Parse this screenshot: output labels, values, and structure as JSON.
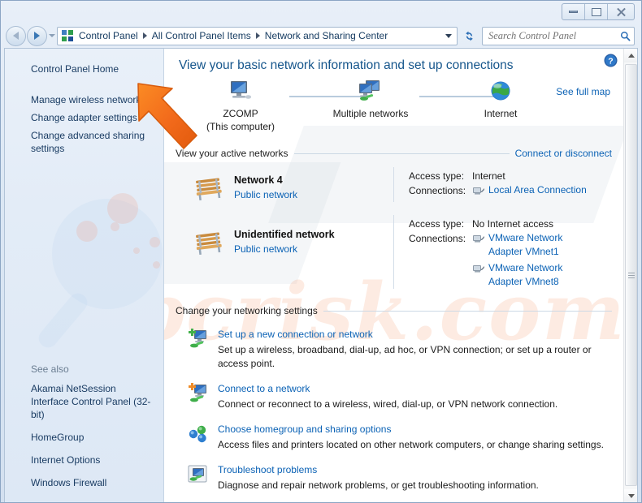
{
  "window": {
    "controls": {
      "minimize": "Minimize",
      "maximize": "Maximize",
      "close": "Close"
    }
  },
  "address_bar": {
    "back_tooltip": "Back",
    "forward_tooltip": "Forward",
    "breadcrumb": [
      "Control Panel",
      "All Control Panel Items",
      "Network and Sharing Center"
    ],
    "refresh_tooltip": "Refresh",
    "search_placeholder": "Search Control Panel",
    "search_value": ""
  },
  "sidebar": {
    "home_label": "Control Panel Home",
    "items": [
      {
        "label": "Manage wireless networks"
      },
      {
        "label": "Change adapter settings"
      },
      {
        "label": "Change advanced sharing settings"
      }
    ],
    "see_also_title": "See also",
    "see_also_items": [
      {
        "label": "Akamai NetSession Interface Control Panel (32-bit)"
      },
      {
        "label": "HomeGroup"
      },
      {
        "label": "Internet Options"
      },
      {
        "label": "Windows Firewall"
      }
    ]
  },
  "main": {
    "title": "View your basic network information and set up connections",
    "see_full_map": "See full map",
    "map_nodes": [
      {
        "label": "ZCOMP",
        "sublabel": "(This computer)",
        "icon": "computer-icon"
      },
      {
        "label": "Multiple networks",
        "sublabel": "",
        "icon": "multiple-networks-icon"
      },
      {
        "label": "Internet",
        "sublabel": "",
        "icon": "globe-icon"
      }
    ],
    "active_networks_heading": "View your active networks",
    "connect_or_disconnect": "Connect or disconnect",
    "networks": [
      {
        "name": "Network  4",
        "type": "Public network",
        "access_type_label": "Access type:",
        "access_type_value": "Internet",
        "connections_label": "Connections:",
        "connections": [
          "Local Area Connection"
        ]
      },
      {
        "name": "Unidentified network",
        "type": "Public network",
        "access_type_label": "Access type:",
        "access_type_value": "No Internet access",
        "connections_label": "Connections:",
        "connections": [
          "VMware Network Adapter VMnet1",
          "VMware Network Adapter VMnet8"
        ]
      }
    ],
    "settings_heading": "Change your networking settings",
    "tasks": [
      {
        "title": "Set up a new connection or network",
        "desc": "Set up a wireless, broadband, dial-up, ad hoc, or VPN connection; or set up a router or access point.",
        "icon": "new-connection-icon"
      },
      {
        "title": "Connect to a network",
        "desc": "Connect or reconnect to a wireless, wired, dial-up, or VPN network connection.",
        "icon": "connect-network-icon"
      },
      {
        "title": "Choose homegroup and sharing options",
        "desc": "Access files and printers located on other network computers, or change sharing settings.",
        "icon": "homegroup-icon"
      },
      {
        "title": "Troubleshoot problems",
        "desc": "Diagnose and repair network problems, or get troubleshooting information.",
        "icon": "troubleshoot-icon"
      }
    ],
    "help_tooltip": "Help"
  },
  "watermark": {
    "text": "pcrisk.com"
  },
  "colors": {
    "link": "#0b62b5",
    "title": "#16568c",
    "pointer": "#f26a1b",
    "sidebar_bg": "#e3ecf7",
    "window_frame": "#d3e0f0"
  }
}
